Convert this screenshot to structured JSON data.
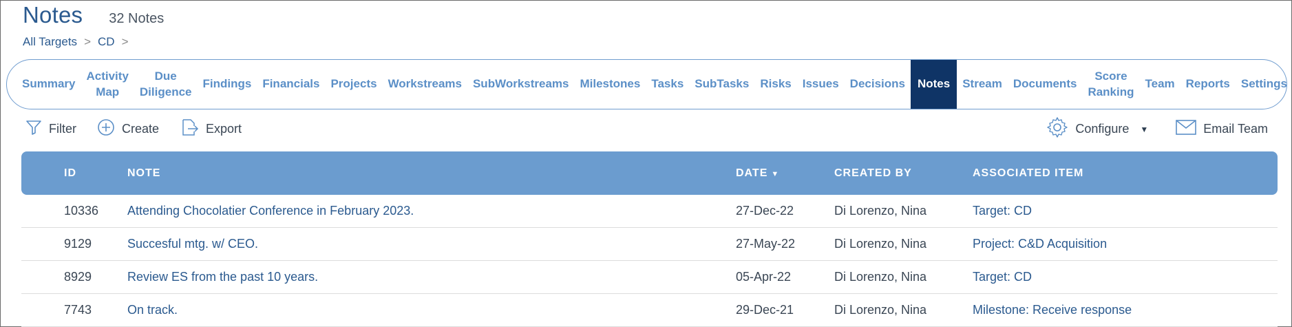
{
  "header": {
    "title": "Notes",
    "count": "32 Notes"
  },
  "breadcrumb": {
    "items": [
      "All Targets",
      "CD"
    ],
    "separator": ">"
  },
  "tabs": [
    {
      "label": "Summary"
    },
    {
      "label": "Activity\nMap"
    },
    {
      "label": "Due\nDiligence"
    },
    {
      "label": "Findings"
    },
    {
      "label": "Financials"
    },
    {
      "label": "Projects"
    },
    {
      "label": "Workstreams"
    },
    {
      "label": "SubWorkstreams"
    },
    {
      "label": "Milestones"
    },
    {
      "label": "Tasks"
    },
    {
      "label": "SubTasks"
    },
    {
      "label": "Risks"
    },
    {
      "label": "Issues"
    },
    {
      "label": "Decisions"
    },
    {
      "label": "Notes",
      "active": true
    },
    {
      "label": "Stream"
    },
    {
      "label": "Documents"
    },
    {
      "label": "Score\nRanking"
    },
    {
      "label": "Team"
    },
    {
      "label": "Reports"
    },
    {
      "label": "Settings"
    }
  ],
  "toolbar": {
    "filter": "Filter",
    "create": "Create",
    "export": "Export",
    "configure": "Configure",
    "email_team": "Email Team"
  },
  "table": {
    "columns": {
      "id": "ID",
      "note": "NOTE",
      "date": "DATE",
      "created_by": "CREATED BY",
      "associated_item": "ASSOCIATED ITEM"
    },
    "rows": [
      {
        "id": "10336",
        "note": "Attending Chocolatier Conference in February 2023.",
        "date": "27-Dec-22",
        "created_by": "Di Lorenzo, Nina",
        "associated_item": "Target: CD"
      },
      {
        "id": "9129",
        "note": "Succesful mtg. w/ CEO.",
        "date": "27-May-22",
        "created_by": "Di Lorenzo, Nina",
        "associated_item": "Project: C&D Acquisition"
      },
      {
        "id": "8929",
        "note": "Review ES from the past 10 years.",
        "date": "05-Apr-22",
        "created_by": "Di Lorenzo, Nina",
        "associated_item": "Target: CD"
      },
      {
        "id": "7743",
        "note": "On track.",
        "date": "29-Dec-21",
        "created_by": "Di Lorenzo, Nina",
        "associated_item": "Milestone: Receive response"
      }
    ]
  },
  "icons": [
    "filter-icon",
    "plus-circle-icon",
    "export-icon",
    "gear-icon",
    "mail-icon"
  ],
  "colors": {
    "accent": "#6b9ccf",
    "active_tab": "#0f3466",
    "link": "#2b5a8f",
    "tab_text": "#5b8fc7"
  }
}
